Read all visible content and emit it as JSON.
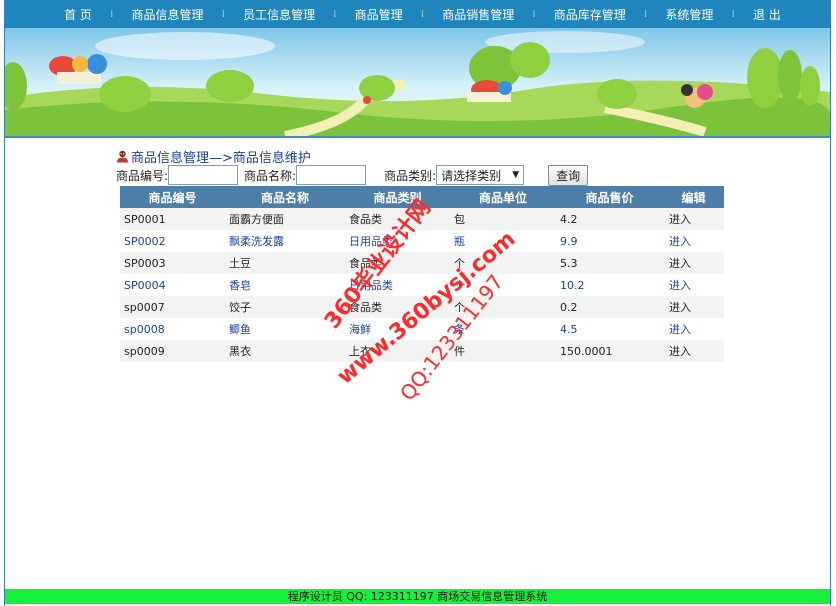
{
  "nav": {
    "items": [
      "首 页",
      "商品信息管理",
      "员工信息管理",
      "商品管理",
      "商品销售管理",
      "商品库存管理",
      "系统管理",
      "退 出"
    ],
    "separator": "⁞"
  },
  "breadcrumb": {
    "text": "商品信息管理—>商品信息维护",
    "icon": "person-icon"
  },
  "search": {
    "code_label": "商品编号:",
    "code_value": "",
    "name_label": "商品名称:",
    "name_value": "",
    "category_label": "商品类别:",
    "category_selected": "请选择类别",
    "query_button": "查询"
  },
  "table": {
    "headers": [
      "商品编号",
      "商品名称",
      "商品类别",
      "商品单位",
      "商品售价",
      "编辑"
    ],
    "rows": [
      [
        "SP0001",
        "面霸方便面",
        "食品类",
        "包",
        "4.2",
        "进入"
      ],
      [
        "SP0002",
        "飘柔洗发露",
        "日用品类",
        "瓶",
        "9.9",
        "进入"
      ],
      [
        "SP0003",
        "土豆",
        "食品类",
        "个",
        "5.3",
        "进入"
      ],
      [
        "SP0004",
        "香皂",
        "日用品类",
        "个",
        "10.2",
        "进入"
      ],
      [
        "sp0007",
        "饺子",
        "食品类",
        "个",
        "0.2",
        "进入"
      ],
      [
        "sp0008",
        "鲫鱼",
        "海鲜",
        "条",
        "4.5",
        "进入"
      ],
      [
        "sp0009",
        "黑衣",
        "上衣",
        "件",
        "150.0001",
        "进入"
      ]
    ]
  },
  "watermark": {
    "line1": "360毕业设计网",
    "line2": "www.360bysj.com",
    "line3": "QQ:123311197",
    "color": "#ff2a2a"
  },
  "footer": {
    "text": "程序设计员 QQ: 123311197 商场交易信息管理系统"
  },
  "colors": {
    "nav_bg": "#1f86bd",
    "header_bg": "#4d7ea8",
    "footer_bg": "#16f03a",
    "link": "#1a3fa8"
  }
}
